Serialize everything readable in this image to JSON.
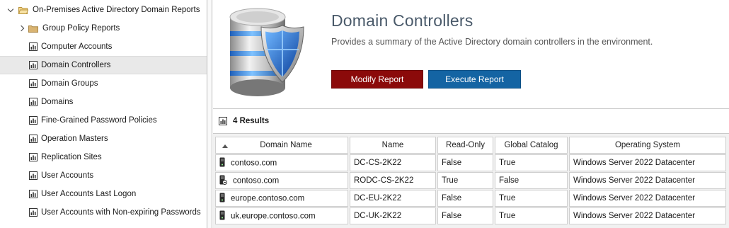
{
  "tree": {
    "root": {
      "label": "On-Premises Active Directory Domain Reports"
    },
    "folder": {
      "label": "Group Policy Reports"
    },
    "items": [
      {
        "label": "Computer Accounts"
      },
      {
        "label": "Domain Controllers",
        "selected": true
      },
      {
        "label": "Domain Groups"
      },
      {
        "label": "Domains"
      },
      {
        "label": "Fine-Grained Password Policies"
      },
      {
        "label": "Operation Masters"
      },
      {
        "label": "Replication Sites"
      },
      {
        "label": "User Accounts"
      },
      {
        "label": "User Accounts Last Logon"
      },
      {
        "label": "User Accounts with Non-expiring Passwords"
      }
    ]
  },
  "header": {
    "title": "Domain Controllers",
    "description": "Provides a summary of the Active Directory domain controllers in the environment.",
    "modify_label": "Modify Report",
    "execute_label": "Execute Report",
    "hero_icon": "database-shield-icon"
  },
  "results": {
    "count_label": "4 Results",
    "columns": [
      "Domain Name",
      "Name",
      "Read-Only",
      "Global Catalog",
      "Operating System"
    ],
    "sorted_column": "Domain Name",
    "rows": [
      {
        "icon": "server-icon",
        "domain": "contoso.com",
        "name": "DC-CS-2K22",
        "readonly": "False",
        "gc": "True",
        "os": "Windows Server 2022 Datacenter"
      },
      {
        "icon": "rodc-server-icon",
        "domain": "contoso.com",
        "name": "RODC-CS-2K22",
        "readonly": "True",
        "gc": "False",
        "os": "Windows Server 2022 Datacenter"
      },
      {
        "icon": "server-icon",
        "domain": "europe.contoso.com",
        "name": "DC-EU-2K22",
        "readonly": "False",
        "gc": "True",
        "os": "Windows Server 2022 Datacenter"
      },
      {
        "icon": "server-icon",
        "domain": "uk.europe.contoso.com",
        "name": "DC-UK-2K22",
        "readonly": "False",
        "gc": "True",
        "os": "Windows Server 2022 Datacenter"
      }
    ]
  },
  "colors": {
    "modify": "#8b0a0a",
    "execute": "#1464a3",
    "title": "#4a5a6a",
    "selected_row": "#e9e9e9"
  }
}
